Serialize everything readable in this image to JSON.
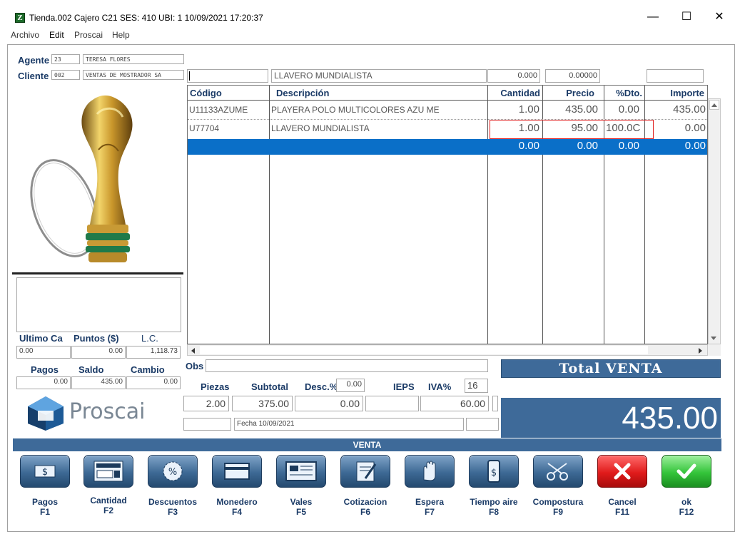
{
  "window": {
    "title": "Tienda.002  Cajero C21     SES: 410  UBI: 1   10/09/2021 17:20:37",
    "minimize": "—",
    "maximize": "☐",
    "close": "✕"
  },
  "menu": [
    "Archivo",
    "Edit",
    "Proscai",
    "Help"
  ],
  "agente": {
    "label": "Agente",
    "code": "23",
    "name": "TERESA FLORES"
  },
  "cliente": {
    "label": "Cliente",
    "code": "002",
    "name": "VENTAS DE MOSTRADOR SA"
  },
  "entry": {
    "code": "",
    "description": "LLAVERO MUNDIALISTA",
    "qty": "0.000",
    "price": "0.00000",
    "extra": ""
  },
  "grid": {
    "headers": [
      "Código",
      "Descripción",
      "Cantidad",
      "Precio",
      "%Dto.",
      "Importe"
    ],
    "rows": [
      {
        "code": "U11133AZUME",
        "desc": "PLAYERA POLO MULTICOLORES AZU ME",
        "qty": "1.00",
        "price": "435.00",
        "dto": "0.00",
        "importe": "435.00"
      },
      {
        "code": "U77704",
        "desc": "LLAVERO MUNDIALISTA",
        "qty": "1.00",
        "price": "95.00",
        "dto": "100.0C",
        "importe": "0.00"
      }
    ],
    "selected": {
      "qty": "0.00",
      "price": "0.00",
      "dto": "0.00",
      "importe": "0.00"
    }
  },
  "stats": {
    "ultimo_label": "Ultimo Ca",
    "puntos_label": "Puntos ($)",
    "lc_label": "L.C.",
    "ultimo": "0.00",
    "puntos": "0.00",
    "lc": "1,118.73",
    "pagos_label": "Pagos",
    "saldo_label": "Saldo",
    "cambio_label": "Cambio",
    "pagos": "0.00",
    "saldo": "435.00",
    "cambio": "0.00"
  },
  "obs": {
    "label": "Obs",
    "value": ""
  },
  "summary": {
    "piezas_label": "Piezas",
    "subtotal_label": "Subtotal",
    "desc_label": "Desc.%",
    "desc_pct": "0.00",
    "ieps_label": "IEPS",
    "iva_label": "IVA%",
    "iva_pct": "16",
    "piezas": "2.00",
    "subtotal": "375.00",
    "desc": "0.00",
    "ieps": "",
    "iva": "60.00",
    "fecha": "Fecha 10/09/2021"
  },
  "total": {
    "label": "Total VENTA",
    "value": "435.00"
  },
  "logo": {
    "text": "Proscai"
  },
  "mode_label": "VENTA",
  "buttons": [
    {
      "name": "pagos",
      "label": "Pagos",
      "key": "F1",
      "icon": "money-icon"
    },
    {
      "name": "cantidad",
      "label": "Cantidad",
      "key": "F2",
      "icon": "calculator-icon"
    },
    {
      "name": "descuentos",
      "label": "Descuentos",
      "key": "F3",
      "icon": "percent-icon"
    },
    {
      "name": "monedero",
      "label": "Monedero",
      "key": "F4",
      "icon": "card-icon"
    },
    {
      "name": "vales",
      "label": "Vales",
      "key": "F5",
      "icon": "voucher-icon"
    },
    {
      "name": "cotizacion",
      "label": "Cotizacion",
      "key": "F6",
      "icon": "quote-icon"
    },
    {
      "name": "espera",
      "label": "Espera",
      "key": "F7",
      "icon": "hand-icon"
    },
    {
      "name": "tiempo-aire",
      "label": "Tiempo aire",
      "key": "F8",
      "icon": "phone-icon"
    },
    {
      "name": "compostura",
      "label": "Compostura",
      "key": "F9",
      "icon": "scissors-icon"
    },
    {
      "name": "cancel",
      "label": "Cancel",
      "key": "F11",
      "icon": "x-icon"
    },
    {
      "name": "ok",
      "label": "ok",
      "key": "F12",
      "icon": "check-icon"
    }
  ],
  "colors": {
    "accent": "#3e6a99",
    "selection": "#0a6fc8",
    "label": "#1a3a66"
  }
}
